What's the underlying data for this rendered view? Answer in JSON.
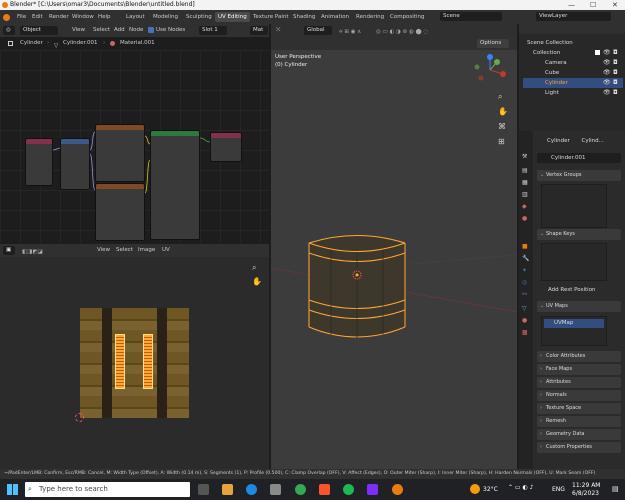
{
  "titlebar": {
    "title": "Blender* [C:\\Users\\omar3\\Documents\\Blender\\untitled.blend]",
    "minimize": "—",
    "maximize": "☐",
    "close": "✕"
  },
  "menu": {
    "items": [
      "File",
      "Edit",
      "Render",
      "Window",
      "Help"
    ]
  },
  "workspaces": [
    "Layout",
    "Modeling",
    "Sculpting",
    "UV Editing",
    "Texture Paint",
    "Shading",
    "Animation",
    "Rendering",
    "Compositing"
  ],
  "active_workspace": "UV Editing",
  "scene_field": "Scene",
  "viewlayer_field": "ViewLayer",
  "node_header": {
    "mode": "Object",
    "items": [
      "View",
      "Select",
      "Add",
      "Node"
    ],
    "use_nodes": "Use Nodes",
    "slot": "Slot 1",
    "mat": "Mat"
  },
  "node_breadcrumb": {
    "obj": "Cylinder",
    "mesh": "Cylinder.001",
    "mat": "Material.001"
  },
  "uv_header": {
    "items": [
      "View",
      "Select",
      "Image",
      "UV"
    ]
  },
  "viewport": {
    "transform": "Global",
    "options": "Options",
    "view_label": "User Perspective",
    "object_label": "(0) Cylinder"
  },
  "outliner": {
    "rows": [
      {
        "label": "Scene Collection"
      },
      {
        "label": "Collection"
      },
      {
        "label": "Camera"
      },
      {
        "label": "Cube"
      },
      {
        "label": "Cylinder"
      },
      {
        "label": "Light"
      }
    ]
  },
  "props": {
    "breadcrumb_a": "Cylinder",
    "breadcrumb_b": "Cylind...",
    "mesh_name": "Cylinder.001",
    "vertex_groups": "Vertex Groups",
    "shape_keys": "Shape Keys",
    "add_rest": "Add Rest Position",
    "uv_maps": "UV Maps",
    "uvmap": "UVMap",
    "panels": [
      "Color Attributes",
      "Face Maps",
      "Attributes",
      "Normals",
      "Texture Space",
      "Remesh",
      "Geometry Data",
      "Custom Properties"
    ]
  },
  "statusbar": "→/PadEnter/LMB: Confirm, Esc/RMB: Cancel, M: Width Type (Offset), A: Width (0.14 m), S: Segments (1), P: Profile (0.500), C: Clamp Overlap (OFF), V: Affect (Edges), O: Outer Miter (Sharp), I: Inner Miter (Sharp), H: Harden Normals (OFF), U: Mark Seam (OFF)",
  "taskbar": {
    "search": "Type here to search",
    "weather": "32°C",
    "lang": "ENG",
    "time": "11:29 AM",
    "date": "6/8/2023"
  },
  "colors": {
    "accent": "#4772b3",
    "orange": "#e87d0d",
    "selected_outline": "#ffa733"
  }
}
